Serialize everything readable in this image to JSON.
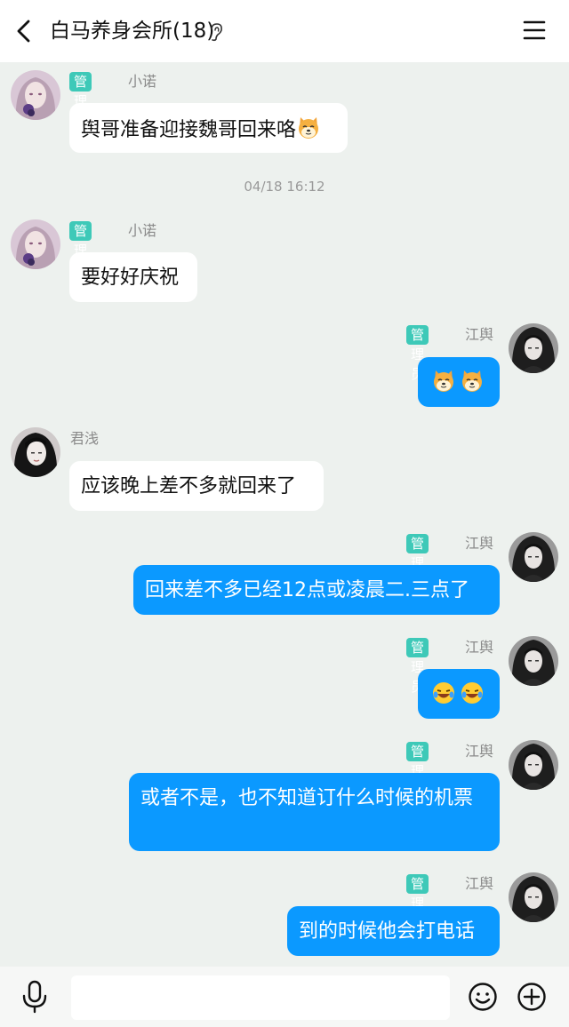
{
  "header": {
    "title": "白马养身会所(18)"
  },
  "timestamp": "04/18 16:12",
  "messages": [
    {
      "role": "管理员",
      "sender": "小诺",
      "text": "舆哥准备迎接魏哥回来咯"
    },
    {
      "role": "管理员",
      "sender": "小诺",
      "text": "要好好庆祝"
    },
    {
      "role": "管理员",
      "sender": "江舆",
      "text": ""
    },
    {
      "sender": "君浅",
      "text": "应该晚上差不多就回来了"
    },
    {
      "role": "管理员",
      "sender": "江舆",
      "text": "回来差不多已经12点或凌晨二.三点了"
    },
    {
      "role": "管理员",
      "sender": "江舆",
      "text": ""
    },
    {
      "role": "管理员",
      "sender": "江舆",
      "text": "或者不是，也不知道订什么时候的机票"
    },
    {
      "role": "管理员",
      "sender": "江舆",
      "text": "到的时候他会打电话"
    }
  ],
  "input": {
    "placeholder": ""
  },
  "colors": {
    "accent": "#0b99ff",
    "badge": "#3ec9b8",
    "background": "#edf1ee"
  },
  "icons": [
    "back-arrow-icon",
    "ear-icon",
    "menu-icon",
    "microphone-icon",
    "smile-icon",
    "plus-icon",
    "doge-emoji",
    "laugh-emoji"
  ]
}
